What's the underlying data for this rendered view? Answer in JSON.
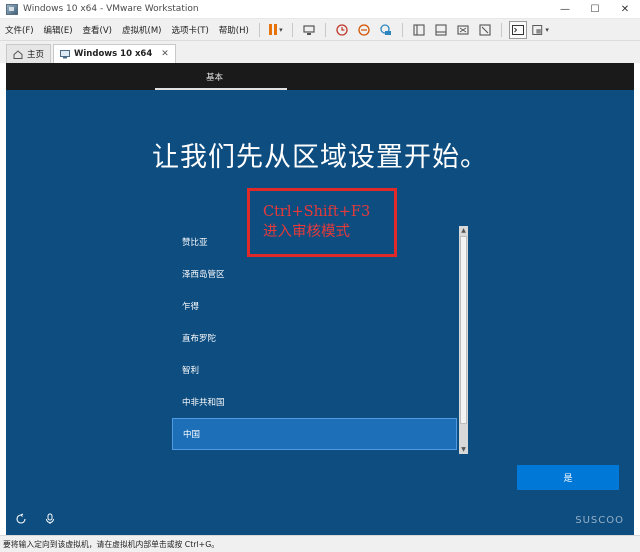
{
  "window": {
    "title": "Windows 10 x64 - VMware Workstation",
    "controls": {
      "minimize": "—",
      "maximize": "☐",
      "close": "✕"
    }
  },
  "menu": {
    "items": [
      "文件(F)",
      "编辑(E)",
      "查看(V)",
      "虚拟机(M)",
      "选项卡(T)",
      "帮助(H)"
    ]
  },
  "toolbar": {
    "icons": [
      "pause-icon",
      "send-keys-icon",
      "snapshot-icon",
      "revert-snapshot-icon",
      "snapshot-manager-icon",
      "sidebar-icon",
      "thumbnail-icon",
      "fullscreen-icon",
      "unity-icon",
      "console-icon",
      "view-icon"
    ],
    "accent": "#e8730c"
  },
  "tabs": [
    {
      "label": "主页",
      "icon": "home-icon",
      "active": false
    },
    {
      "label": "Windows 10 x64",
      "icon": "vm-icon",
      "active": true,
      "close": "✕"
    }
  ],
  "vm_screen": {
    "top_label": "基本",
    "heading": "让我们先从区域设置开始。",
    "list_items": [
      {
        "label": "赞比亚",
        "selected": false
      },
      {
        "label": "泽西岛管区",
        "selected": false
      },
      {
        "label": "乍得",
        "selected": false
      },
      {
        "label": "直布罗陀",
        "selected": false
      },
      {
        "label": "智利",
        "selected": false
      },
      {
        "label": "中非共和国",
        "selected": false
      },
      {
        "label": "中国",
        "selected": true
      }
    ],
    "annotation": {
      "line1": "Ctrl+Shift+F3",
      "line2": "进入审核模式",
      "color": "#e02a2a"
    },
    "yes_button": "是",
    "bottom_icons": [
      "accessibility-icon",
      "microphone-icon"
    ],
    "watermark": "SUSCOO",
    "colors": {
      "background": "#0e4d80",
      "selected": "#1d6fb8",
      "button": "#0078d7"
    }
  },
  "statusbar": {
    "text": "要将输入定向到该虚拟机，请在虚拟机内部单击或按 Ctrl+G。"
  }
}
